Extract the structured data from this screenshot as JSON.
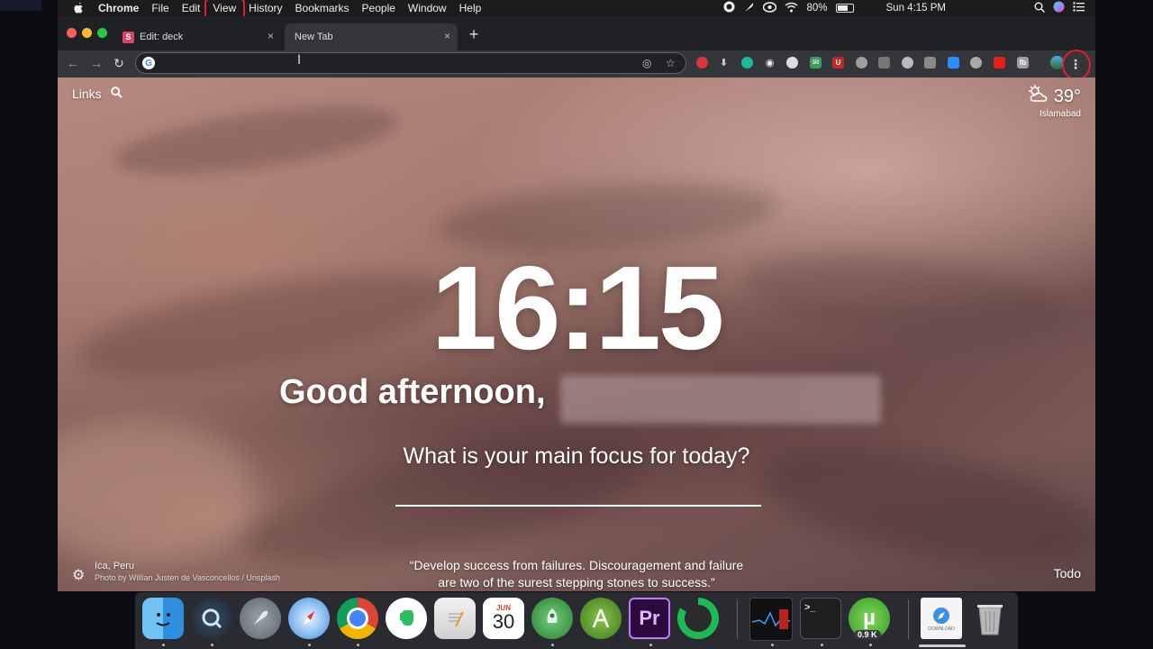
{
  "menubar": {
    "app_name": "Chrome",
    "items": [
      "File",
      "Edit",
      "View",
      "History",
      "Bookmarks",
      "People",
      "Window",
      "Help"
    ],
    "highlighted_item": "View",
    "battery": "80%",
    "battery_level": 0.8,
    "clock": "Sun 4:15 PM"
  },
  "tabs": [
    {
      "label": "Edit: deck",
      "favicon_letter": "S",
      "active": false
    },
    {
      "label": "New Tab",
      "active": true
    }
  ],
  "omnibox": {
    "value": "",
    "placeholder": ""
  },
  "icons": {
    "back": "←",
    "forward": "→",
    "reload": "↻",
    "star": "☆",
    "location": "◎",
    "search": "⚲",
    "gear": "⚙",
    "menu": "⋮",
    "new_tab": "+",
    "close": "×",
    "weather": "☁"
  },
  "momentum": {
    "links_label": "Links",
    "weather": {
      "temp": "39°",
      "location": "Islamabad"
    },
    "time": "16:15",
    "greeting": "Good afternoon,",
    "focus_question": "What is your main focus for today?",
    "photo_location": "Ica, Peru",
    "photo_credit": "Photo by Willian Justen de Vasconcellos / Unsplash",
    "quote_line1": "“Develop success from failures. Discouragement and failure",
    "quote_line2": "are two of the surest stepping stones to success.”",
    "todo_label": "Todo"
  },
  "dock": {
    "calendar_month": "JUN",
    "calendar_day": "30",
    "premiere_label": "Pr",
    "utorrent_badge": "0.9 K",
    "download_label": "DOWNLOAD"
  }
}
